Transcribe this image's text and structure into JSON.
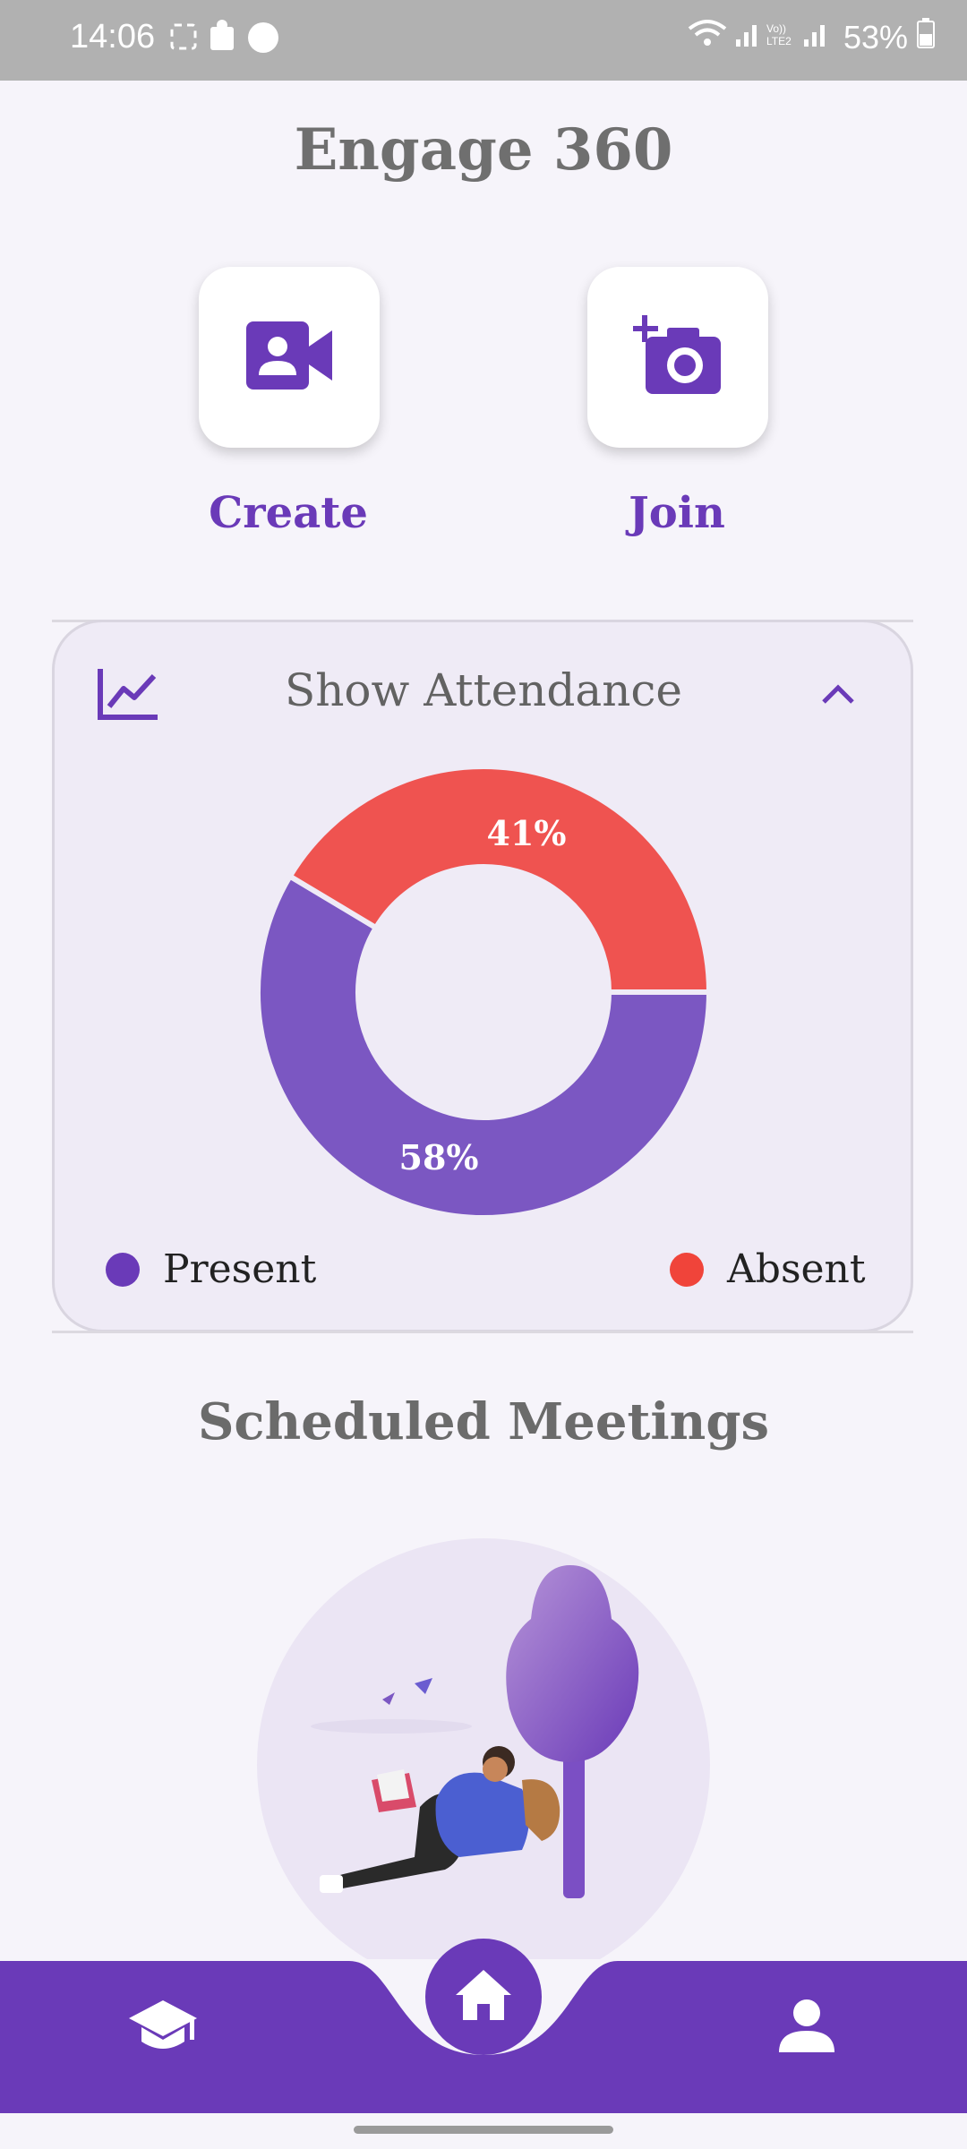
{
  "status_bar": {
    "time": "14:06",
    "battery": "53%"
  },
  "app": {
    "title": "Engage 360"
  },
  "actions": {
    "create_label": "Create",
    "join_label": "Join"
  },
  "attendance": {
    "title": "Show Attendance"
  },
  "chart_data": {
    "type": "pie",
    "title": "",
    "categories": [
      "Present",
      "Absent"
    ],
    "values": [
      58,
      41
    ],
    "labels": [
      "58%",
      "41%"
    ],
    "colors": [
      "#7b57c2",
      "#ef5350"
    ],
    "donut": true,
    "legend_position": "bottom"
  },
  "legend": {
    "present": "Present",
    "absent": "Absent"
  },
  "scheduled": {
    "title": "Scheduled Meetings"
  },
  "colors": {
    "accent": "#6a3ab8",
    "present": "#6a3ab8",
    "absent": "#f0443a"
  },
  "icons": {
    "create": "video-call-icon",
    "join": "add-camera-icon",
    "attendance": "trending-chart-icon",
    "collapse": "chevron-up-icon",
    "nav_left": "school-icon",
    "nav_center": "home-icon",
    "nav_right": "person-icon"
  }
}
